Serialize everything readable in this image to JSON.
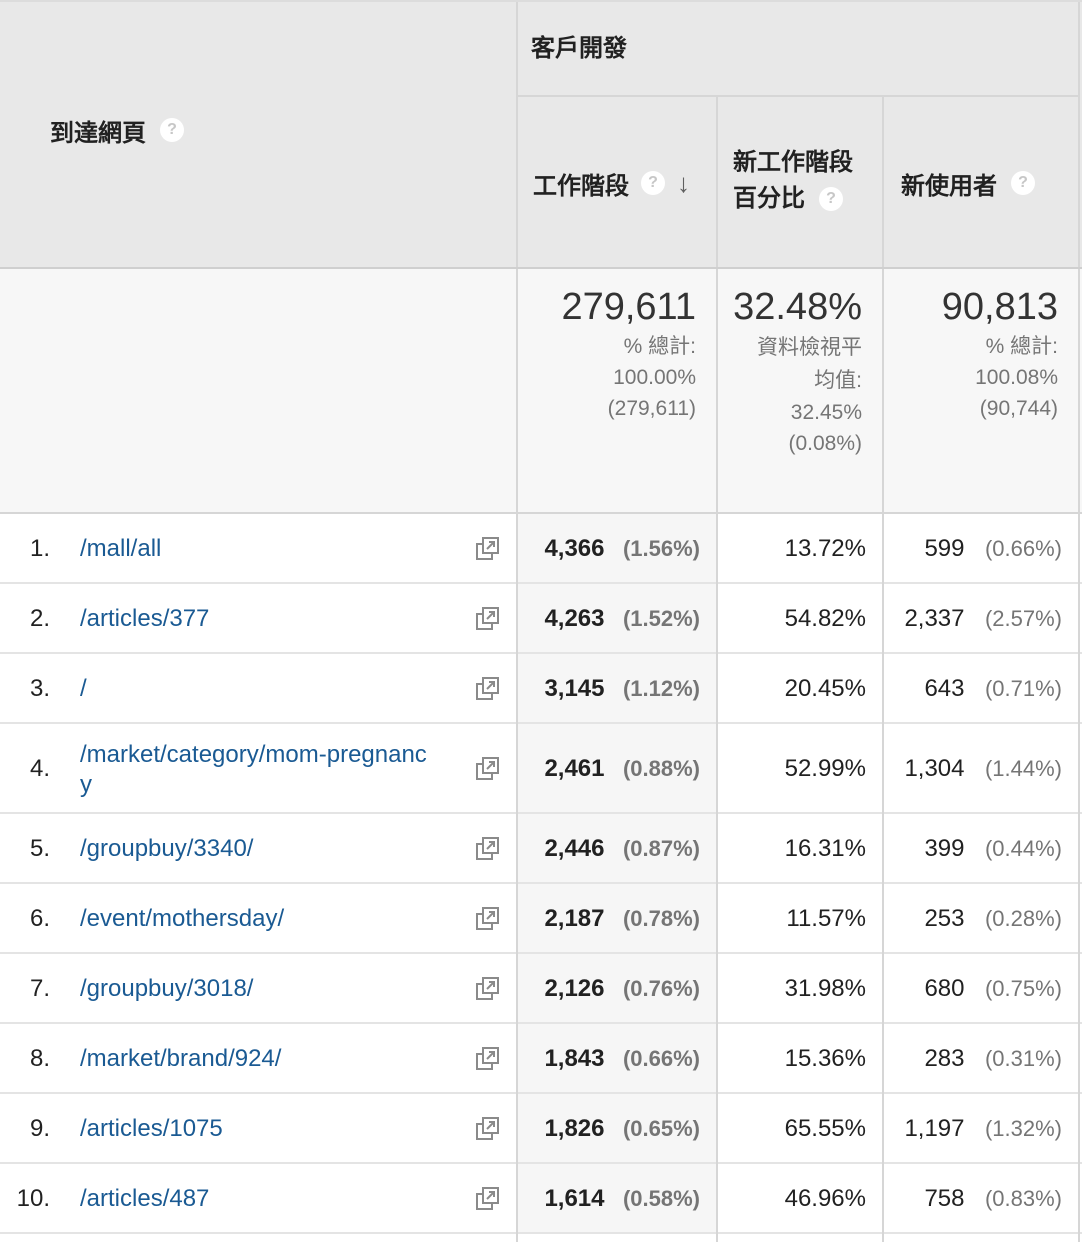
{
  "header": {
    "dimension_label": "到達網頁",
    "group_label": "客戶開發",
    "col_sessions": "工作階段",
    "col_new_sessions_line1": "新工作階段",
    "col_new_sessions_line2": "百分比",
    "col_new_users": "新使用者",
    "help_glyph": "?",
    "sort_glyph": "↓"
  },
  "totals": {
    "sessions": {
      "value": "279,611",
      "line1": "% 總計:",
      "line2": "100.00%",
      "line3": "(279,611)"
    },
    "new_sessions_pct": {
      "value": "32.48%",
      "line1": "資料檢視平",
      "line2": "均值:",
      "line3": "32.45%",
      "line4": "(0.08%)"
    },
    "new_users": {
      "value": "90,813",
      "line1": "% 總計:",
      "line2": "100.08%",
      "line3": "(90,744)"
    }
  },
  "rows": [
    {
      "index": "1.",
      "page": "/mall/all",
      "sessions": "4,366",
      "sessions_pct": "(1.56%)",
      "new_pct": "13.72%",
      "users": "599",
      "users_pct": "(0.66%)"
    },
    {
      "index": "2.",
      "page": "/articles/377",
      "sessions": "4,263",
      "sessions_pct": "(1.52%)",
      "new_pct": "54.82%",
      "users": "2,337",
      "users_pct": "(2.57%)"
    },
    {
      "index": "3.",
      "page": "/",
      "sessions": "3,145",
      "sessions_pct": "(1.12%)",
      "new_pct": "20.45%",
      "users": "643",
      "users_pct": "(0.71%)"
    },
    {
      "index": "4.",
      "page_line1": "/market/category/mom-pregnanc",
      "page_line2": "y",
      "sessions": "2,461",
      "sessions_pct": "(0.88%)",
      "new_pct": "52.99%",
      "users": "1,304",
      "users_pct": "(1.44%)"
    },
    {
      "index": "5.",
      "page": "/groupbuy/3340/",
      "sessions": "2,446",
      "sessions_pct": "(0.87%)",
      "new_pct": "16.31%",
      "users": "399",
      "users_pct": "(0.44%)"
    },
    {
      "index": "6.",
      "page": "/event/mothersday/",
      "sessions": "2,187",
      "sessions_pct": "(0.78%)",
      "new_pct": "11.57%",
      "users": "253",
      "users_pct": "(0.28%)"
    },
    {
      "index": "7.",
      "page": "/groupbuy/3018/",
      "sessions": "2,126",
      "sessions_pct": "(0.76%)",
      "new_pct": "31.98%",
      "users": "680",
      "users_pct": "(0.75%)"
    },
    {
      "index": "8.",
      "page": "/market/brand/924/",
      "sessions": "1,843",
      "sessions_pct": "(0.66%)",
      "new_pct": "15.36%",
      "users": "283",
      "users_pct": "(0.31%)"
    },
    {
      "index": "9.",
      "page": "/articles/1075",
      "sessions": "1,826",
      "sessions_pct": "(0.65%)",
      "new_pct": "65.55%",
      "users": "1,197",
      "users_pct": "(1.32%)"
    },
    {
      "index": "10.",
      "page": "/articles/487",
      "sessions": "1,614",
      "sessions_pct": "(0.58%)",
      "new_pct": "46.96%",
      "users": "758",
      "users_pct": "(0.83%)"
    }
  ],
  "icons": {
    "open_page": "open-in-new-window-icon",
    "help": "help-circle-icon",
    "sort": "sort-descending-arrow-icon"
  },
  "colors": {
    "link": "#1a5a93",
    "header_bg": "#e8e8e8",
    "muted": "#757575"
  }
}
